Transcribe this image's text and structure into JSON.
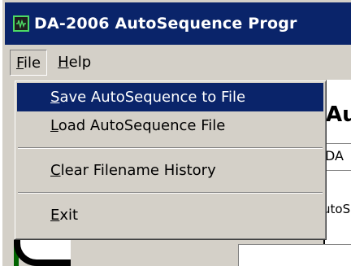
{
  "window": {
    "title": "DA-2006 AutoSequence Progr"
  },
  "menubar": {
    "file_label": "File",
    "file_mnemonic": "F",
    "file_rest": "ile",
    "help_label": "Help",
    "help_mnemonic": "H",
    "help_rest": "elp"
  },
  "file_menu": {
    "items": [
      {
        "mnemonic": "S",
        "rest": "ave AutoSequence to File"
      },
      {
        "mnemonic": "L",
        "rest": "oad AutoSequence File"
      },
      {
        "mnemonic": "C",
        "rest": "lear Filename History"
      },
      {
        "mnemonic": "E",
        "rest": "xit"
      }
    ],
    "selected_index": 0
  },
  "background": {
    "header_text": "Au",
    "field_text": "DA",
    "label_text": "utoS"
  },
  "colors": {
    "titlebar": "#0a246a",
    "selection": "#0a246a",
    "face": "#d4d0c8"
  }
}
